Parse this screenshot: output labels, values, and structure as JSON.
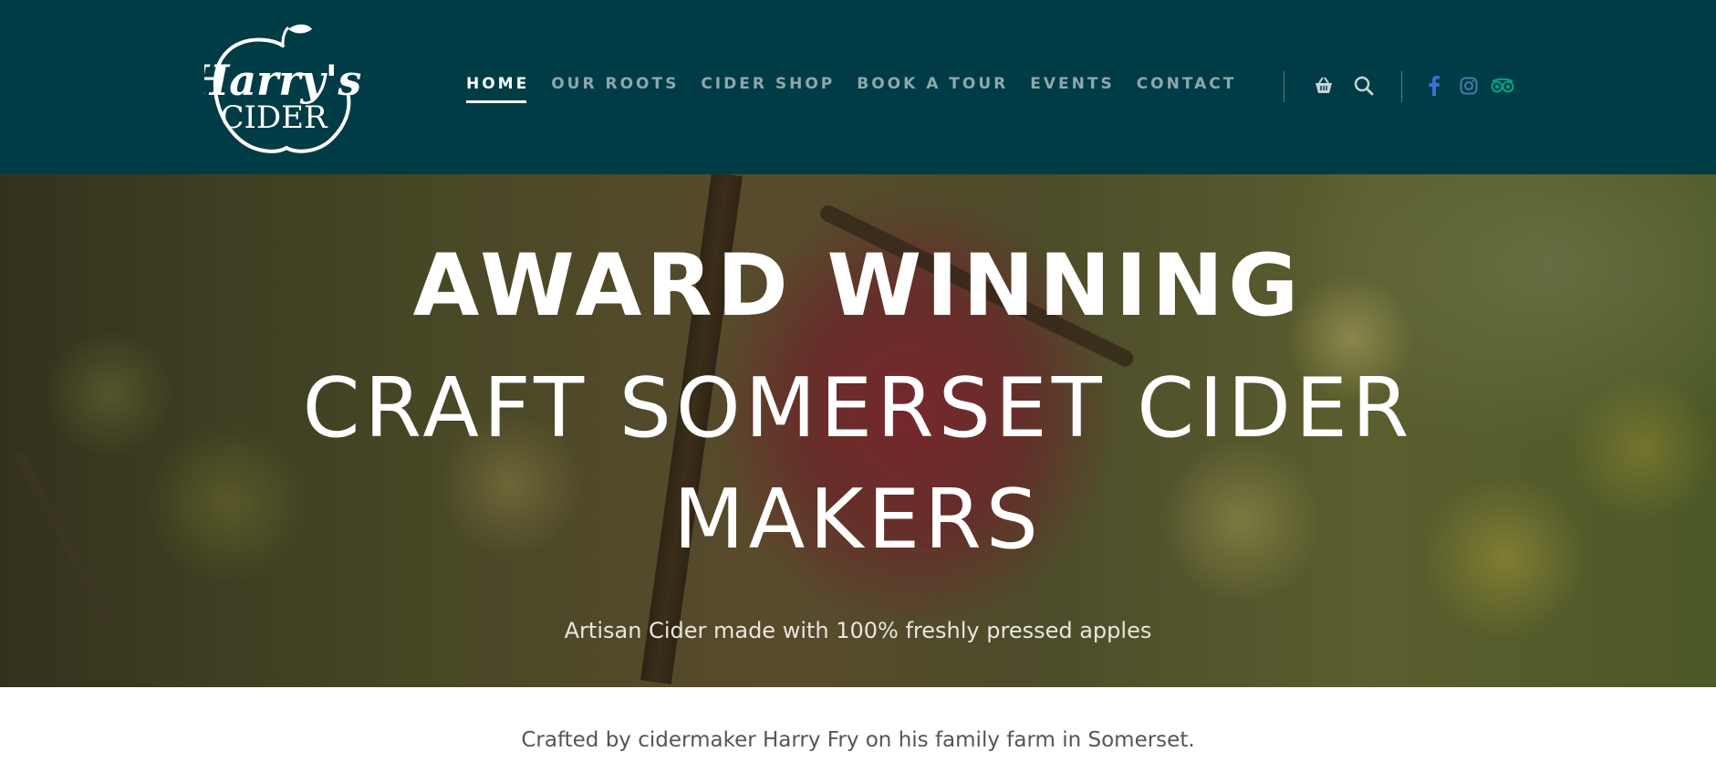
{
  "brand": {
    "logo_line1": "Harry's",
    "logo_line2": "CIDER"
  },
  "nav": {
    "items": [
      {
        "label": "HOME",
        "active": true
      },
      {
        "label": "OUR ROOTS",
        "active": false
      },
      {
        "label": "CIDER SHOP",
        "active": false
      },
      {
        "label": "BOOK A TOUR",
        "active": false
      },
      {
        "label": "EVENTS",
        "active": false
      },
      {
        "label": "CONTACT",
        "active": false
      }
    ]
  },
  "header_icons": {
    "basket": "basket-icon",
    "search": "search-icon",
    "facebook": "facebook-icon",
    "instagram": "instagram-icon",
    "tripadvisor": "tripadvisor-icon"
  },
  "hero": {
    "line1": "AWARD WINNING",
    "line2": "CRAFT SOMERSET CIDER",
    "line3": "MAKERS",
    "subtitle": "Artisan Cider made with 100% freshly pressed apples"
  },
  "intro": {
    "text": "Crafted by cidermaker Harry Fry on his family farm in Somerset."
  },
  "colors": {
    "header_bg": "#003c46",
    "nav_inactive": "#8fa7ac",
    "nav_active": "#ffffff",
    "facebook": "#3b6fd6",
    "instagram": "#3f7fa8",
    "tripadvisor": "#00a680"
  }
}
